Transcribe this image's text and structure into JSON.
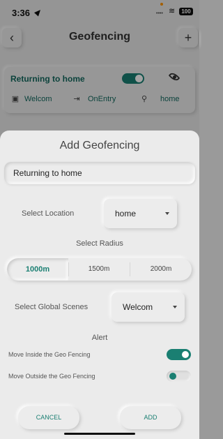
{
  "status_bar": {
    "time": "3:36",
    "signal": "••••",
    "battery": "100"
  },
  "screen": {
    "title": "Geofencing",
    "back_glyph": "‹",
    "add_glyph": "+",
    "card": {
      "title": "Returning to home",
      "toggle_on": true,
      "scene": "Welcom",
      "trigger": "OnEntry",
      "location": "home"
    }
  },
  "sheet": {
    "title": "Add Geofencing",
    "name_value": "Returning to home",
    "location_label": "Select Location",
    "location_value": "home",
    "radius_label": "Select Radius",
    "radius_options": [
      "1000m",
      "1500m",
      "2000m"
    ],
    "radius_selected": "1000m",
    "scenes_label": "Select Global Scenes",
    "scenes_value": "Welcom",
    "alert_label": "Alert",
    "alerts": [
      {
        "label": "Move Inside the Geo Fencing",
        "on": true
      },
      {
        "label": "Move Outside the Geo Fencing",
        "on": false
      }
    ],
    "cancel_label": "CANCEL",
    "add_label": "ADD"
  },
  "colors": {
    "accent": "#1a7f72",
    "surface": "#ececec",
    "accent_text": "#13695f"
  },
  "icons": [
    "location-arrow-icon",
    "wifi-icon",
    "battery-icon",
    "back-icon",
    "plus-icon",
    "eye-icon",
    "scene-icon",
    "entry-icon",
    "map-pin-icon",
    "caret-down-icon"
  ]
}
